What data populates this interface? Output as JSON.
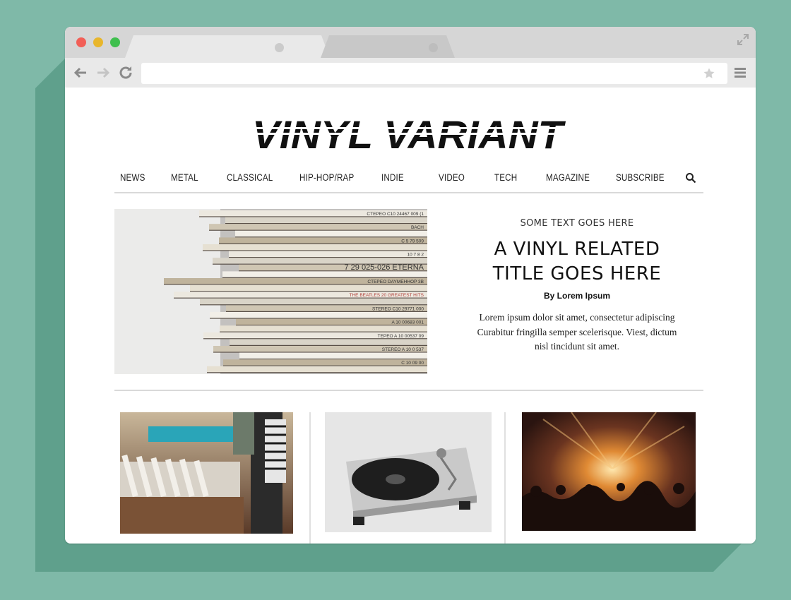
{
  "browser": {
    "url": "",
    "colors": {
      "close": "#f25f57",
      "minimize": "#e8b62c",
      "maximize": "#3fbf4e"
    }
  },
  "site": {
    "logo_text": "VINYL VARIANT",
    "nav": [
      "NEWS",
      "METAL",
      "CLASSICAL",
      "HIP-HOP/RAP",
      "INDIE",
      "VIDEO",
      "TECH",
      "MAGAZINE",
      "SUBSCRIBE"
    ]
  },
  "hero": {
    "kicker": "SOME TEXT GOES HERE",
    "title_line1": "A VINYL RELATED",
    "title_line2": "TITLE GOES HERE",
    "byline": "By Lorem Ipsum",
    "excerpt": "Lorem ipsum dolor sit amet, consectetur adipiscing Curabitur fringilla semper scelerisque. Viest, dictum nisl tincidunt sit amet.",
    "spines": [
      "CTEPEO  C10 24467 009 (1",
      "BACH",
      "C 5 79 509",
      "10 7 8 2",
      "7 29 025-026   ETERNA",
      "CTEPEO   DAYMEHHOP 3B",
      "THE BEATLES   20 GREATEST HITS",
      "STEREO C10 29771 000",
      "A 10 00683 001",
      "TEPEO  A 10 00537 09",
      "STEREO  A 10 0 537",
      "C 10 09 00"
    ]
  },
  "cards": [
    {
      "name": "record-store-photo"
    },
    {
      "name": "turntable-photo"
    },
    {
      "name": "concert-crowd-photo"
    }
  ]
}
